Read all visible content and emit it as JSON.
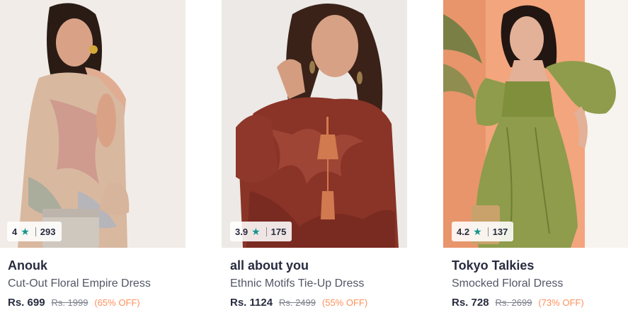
{
  "products": [
    {
      "brand": "Anouk",
      "title": "Cut-Out Floral Empire Dress",
      "rating": "4",
      "rating_count": "293",
      "price": "Rs. 699",
      "mrp": "Rs. 1999",
      "discount": "(65% OFF)"
    },
    {
      "brand": "all about you",
      "title": "Ethnic Motifs Tie-Up Dress",
      "rating": "3.9",
      "rating_count": "175",
      "price": "Rs. 1124",
      "mrp": "Rs. 2499",
      "discount": "(55% OFF)"
    },
    {
      "brand": "Tokyo Talkies",
      "title": "Smocked Floral Dress",
      "rating": "4.2",
      "rating_count": "137",
      "price": "Rs. 728",
      "mrp": "Rs. 2699",
      "discount": "(73% OFF)"
    }
  ],
  "icons": {
    "rating_star": "star-icon"
  },
  "colors": {
    "star": "#14958f",
    "discount": "#ff905a",
    "brand_text": "#282c3f"
  }
}
